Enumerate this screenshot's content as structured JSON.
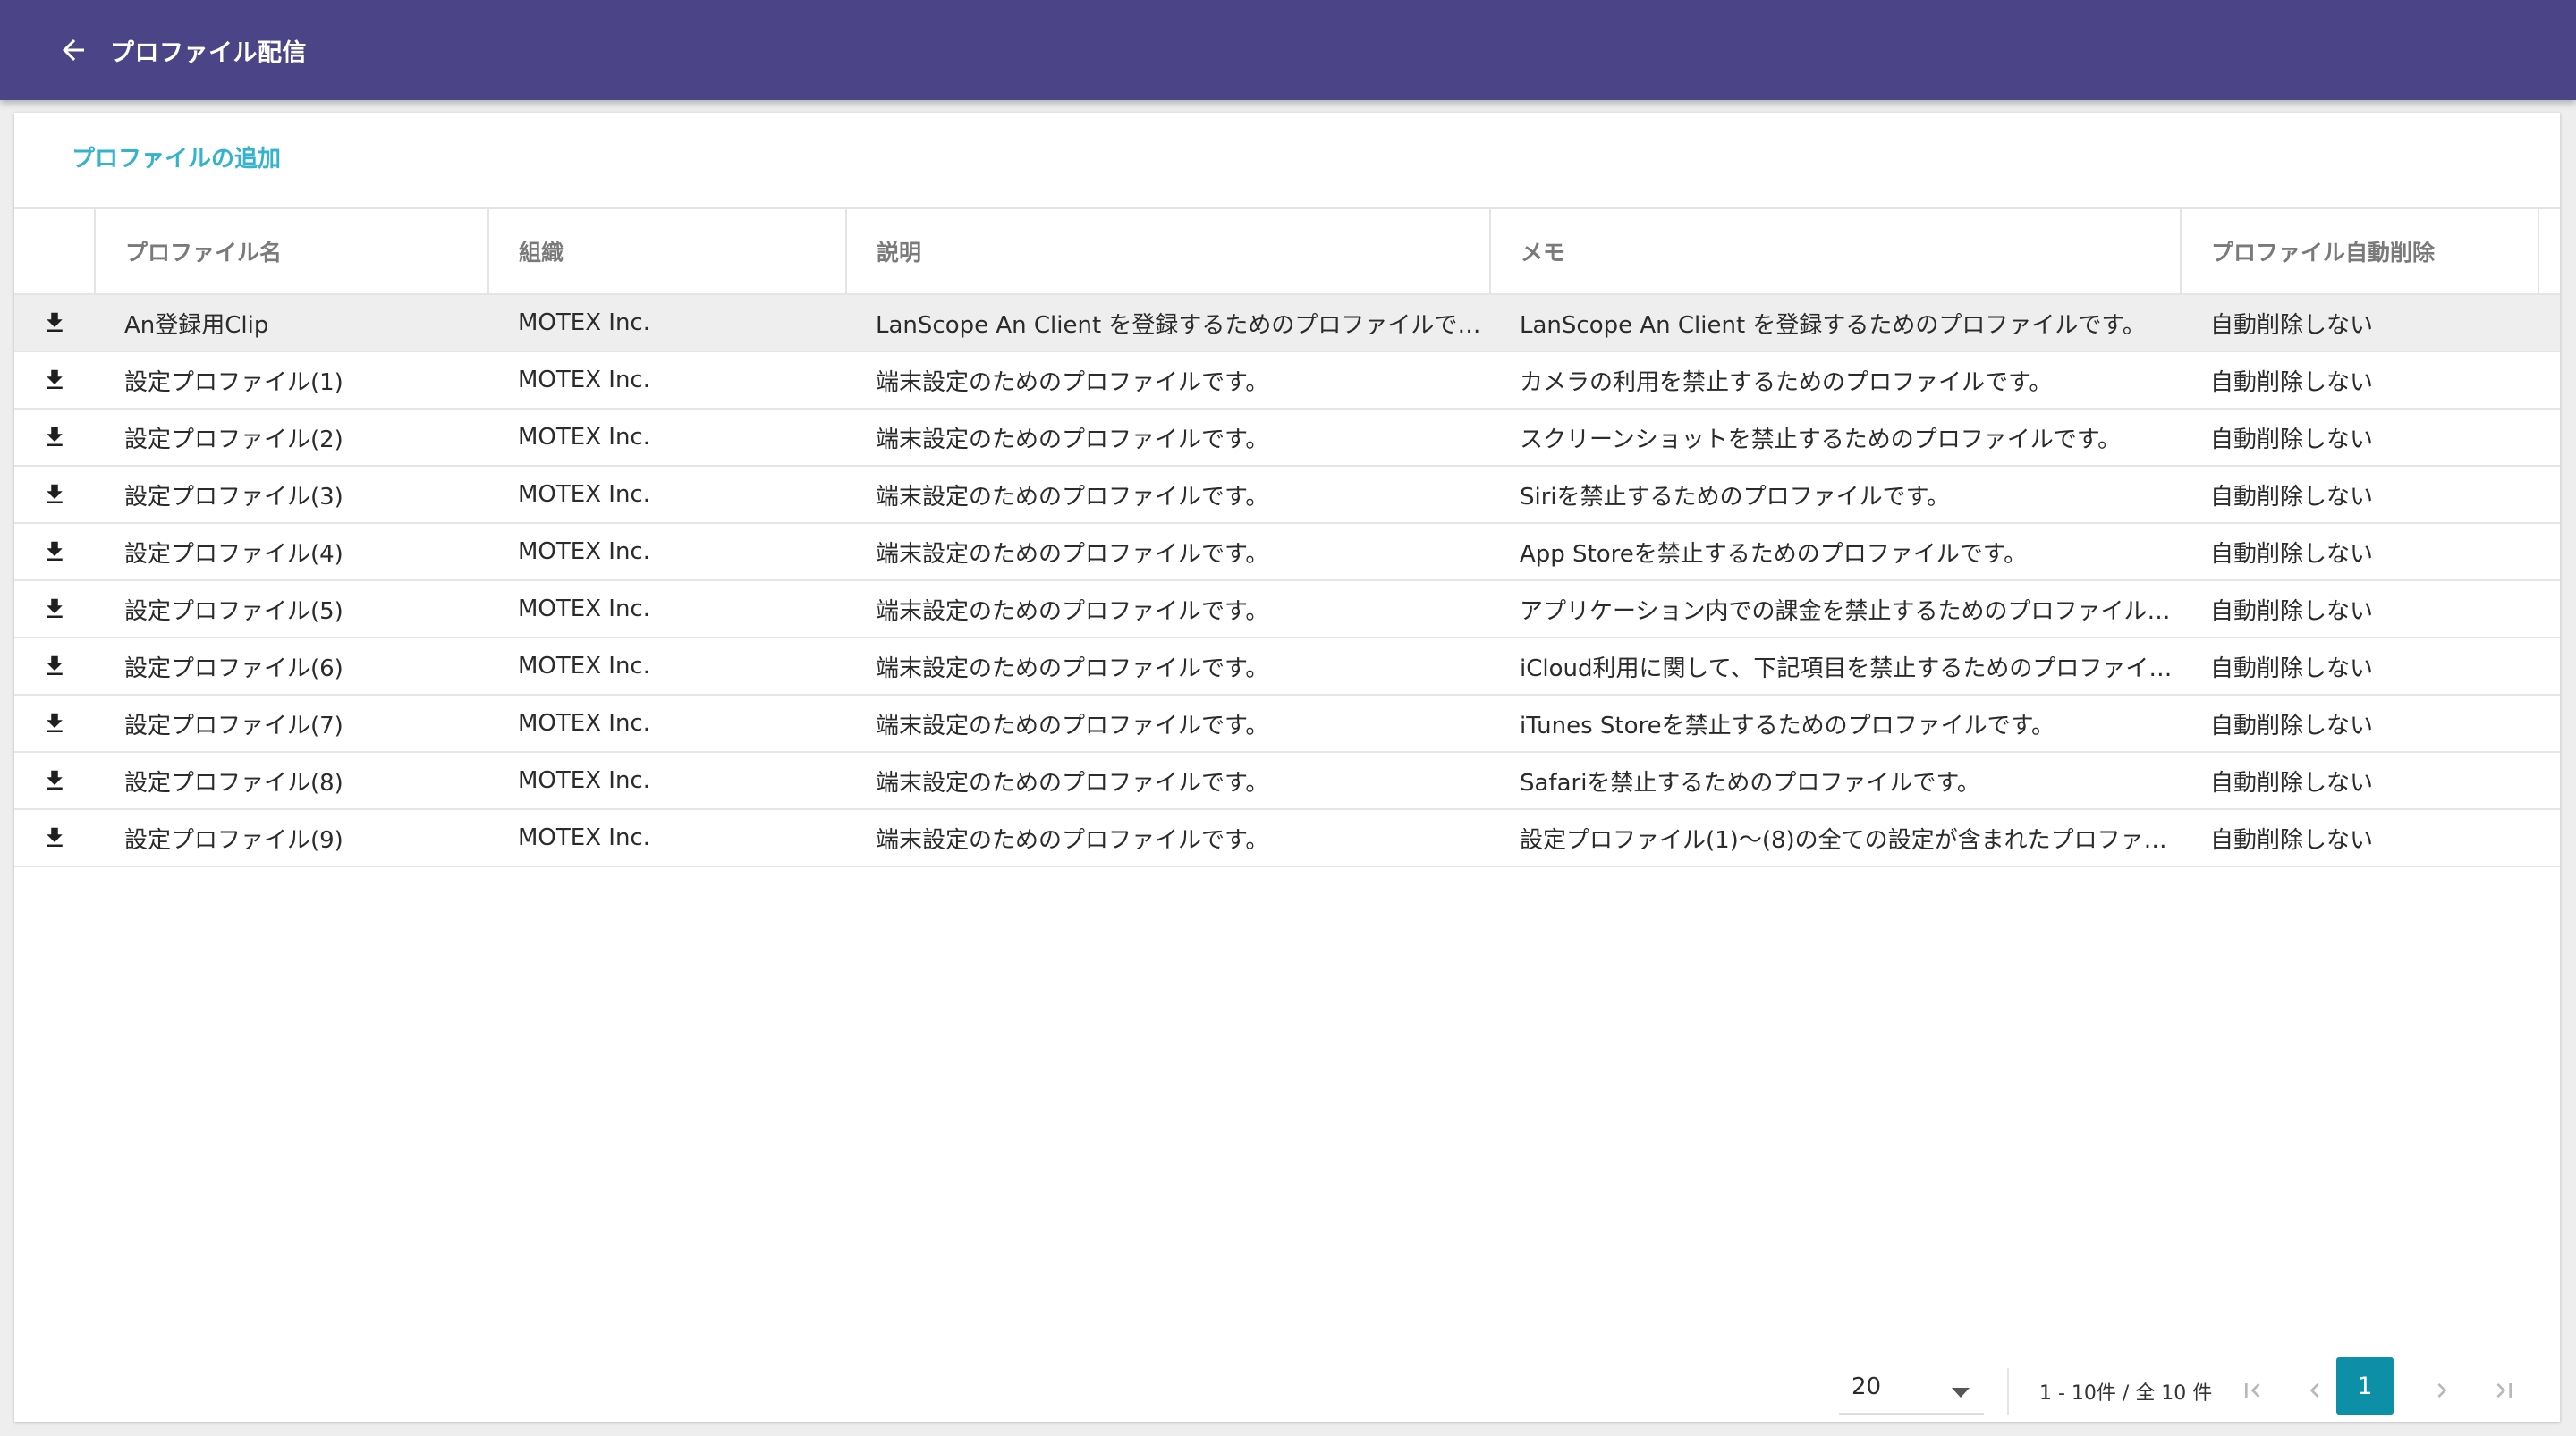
{
  "header": {
    "title": "プロファイル配信"
  },
  "actions": {
    "add_profile": "プロファイルの追加"
  },
  "table": {
    "columns": [
      "プロファイル名",
      "組織",
      "説明",
      "メモ",
      "プロファイル自動削除"
    ],
    "rows": [
      {
        "name": "An登録用Clip",
        "org": "MOTEX Inc.",
        "description": "LanScope An Client を登録するためのプロファイルです。",
        "memo": "LanScope An Client を登録するためのプロファイルです。",
        "auto_delete": "自動削除しない"
      },
      {
        "name": "設定プロファイル(1)",
        "org": "MOTEX Inc.",
        "description": "端末設定のためのプロファイルです。",
        "memo": "カメラの利用を禁止するためのプロファイルです。",
        "auto_delete": "自動削除しない"
      },
      {
        "name": "設定プロファイル(2)",
        "org": "MOTEX Inc.",
        "description": "端末設定のためのプロファイルです。",
        "memo": "スクリーンショットを禁止するためのプロファイルです。",
        "auto_delete": "自動削除しない"
      },
      {
        "name": "設定プロファイル(3)",
        "org": "MOTEX Inc.",
        "description": "端末設定のためのプロファイルです。",
        "memo": "Siriを禁止するためのプロファイルです。",
        "auto_delete": "自動削除しない"
      },
      {
        "name": "設定プロファイル(4)",
        "org": "MOTEX Inc.",
        "description": "端末設定のためのプロファイルです。",
        "memo": "App Storeを禁止するためのプロファイルです。",
        "auto_delete": "自動削除しない"
      },
      {
        "name": "設定プロファイル(5)",
        "org": "MOTEX Inc.",
        "description": "端末設定のためのプロファイルです。",
        "memo": "アプリケーション内での課金を禁止するためのプロファイル…",
        "auto_delete": "自動削除しない"
      },
      {
        "name": "設定プロファイル(6)",
        "org": "MOTEX Inc.",
        "description": "端末設定のためのプロファイルです。",
        "memo": "iCloud利用に関して、下記項目を禁止するためのプロファイ…",
        "auto_delete": "自動削除しない"
      },
      {
        "name": "設定プロファイル(7)",
        "org": "MOTEX Inc.",
        "description": "端末設定のためのプロファイルです。",
        "memo": "iTunes Storeを禁止するためのプロファイルです。",
        "auto_delete": "自動削除しない"
      },
      {
        "name": "設定プロファイル(8)",
        "org": "MOTEX Inc.",
        "description": "端末設定のためのプロファイルです。",
        "memo": "Safariを禁止するためのプロファイルです。",
        "auto_delete": "自動削除しない"
      },
      {
        "name": "設定プロファイル(9)",
        "org": "MOTEX Inc.",
        "description": "端末設定のためのプロファイルです。",
        "memo": "設定プロファイル(1)〜(8)の全ての設定が含まれたプロファ…",
        "auto_delete": "自動削除しない"
      }
    ]
  },
  "pagination": {
    "page_size": "20",
    "range": "1 - 10件 / 全 10 件",
    "current_page": "1"
  },
  "icons": {
    "back": "arrow-left-icon",
    "row_action": "download-icon",
    "first_page": "first-page-icon",
    "prev_page": "chevron-left-icon",
    "next_page": "chevron-right-icon",
    "last_page": "last-page-icon",
    "page_size_toggle": "caret-down-icon"
  },
  "colors": {
    "header_bg": "#4b4486",
    "link": "#33b3cf",
    "current_page_bg": "#0e8fa8",
    "selected_row_bg": "#eeeeee"
  }
}
